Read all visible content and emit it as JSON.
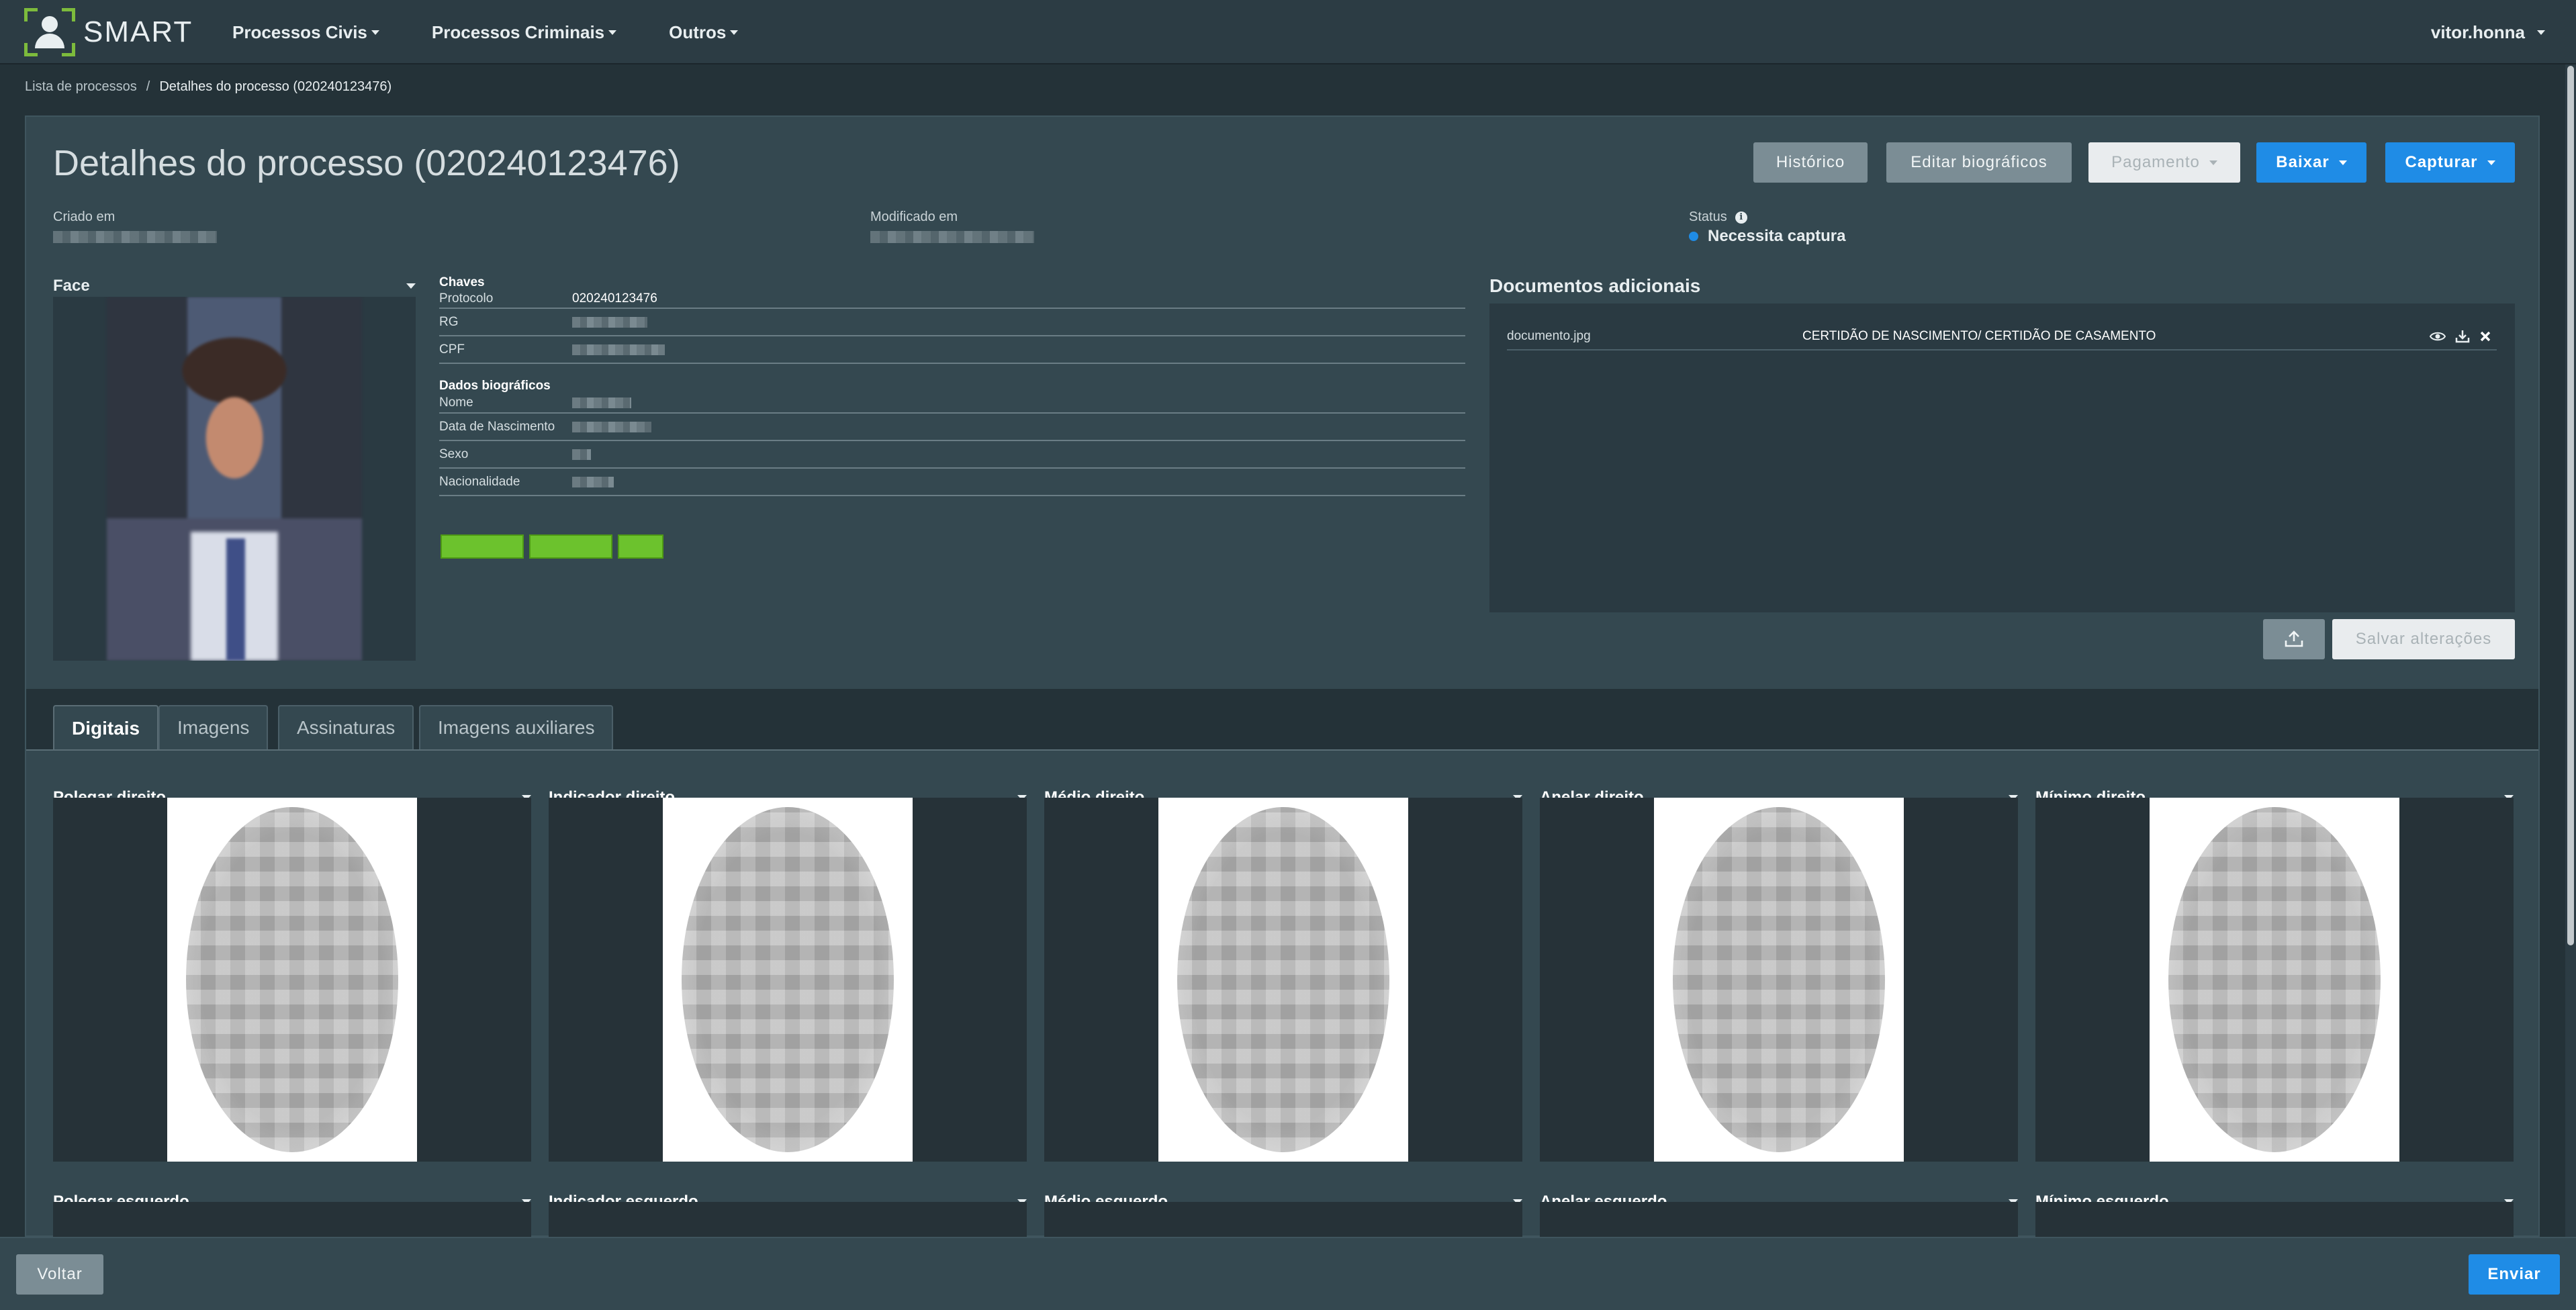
{
  "app": {
    "logo_text": "SMART"
  },
  "nav": {
    "items": [
      {
        "label": "Processos Civis"
      },
      {
        "label": "Processos Criminais"
      },
      {
        "label": "Outros"
      }
    ],
    "user": "vitor.honna"
  },
  "breadcrumb": {
    "parent": "Lista de processos",
    "separator": "/",
    "current": "Detalhes do processo (020240123476)"
  },
  "header": {
    "title": "Detalhes do processo (020240123476)",
    "buttons": {
      "historico": "Histórico",
      "editar": "Editar biográficos",
      "pagamento": "Pagamento",
      "baixar": "Baixar",
      "capturar": "Capturar"
    }
  },
  "meta": {
    "criado_label": "Criado em",
    "modificado_label": "Modificado em",
    "status_label": "Status",
    "status_value": "Necessita captura",
    "status_color": "#1f8ce6"
  },
  "face": {
    "label": "Face"
  },
  "chaves": {
    "title": "Chaves",
    "rows": [
      {
        "key": "Protocolo",
        "value": "020240123476"
      },
      {
        "key": "RG",
        "value": ""
      },
      {
        "key": "CPF",
        "value": ""
      }
    ]
  },
  "biograficos": {
    "title": "Dados biográficos",
    "rows": [
      {
        "key": "Nome"
      },
      {
        "key": "Data de Nascimento"
      },
      {
        "key": "Sexo"
      },
      {
        "key": "Nacionalidade"
      }
    ]
  },
  "documents": {
    "title": "Documentos adicionais",
    "items": [
      {
        "name": "documento.jpg",
        "type": "CERTIDÃO DE NASCIMENTO/ CERTIDÃO DE CASAMENTO"
      }
    ],
    "save_label": "Salvar alterações"
  },
  "tabs": [
    {
      "label": "Digitais",
      "active": true
    },
    {
      "label": "Imagens"
    },
    {
      "label": "Assinaturas"
    },
    {
      "label": "Imagens auxiliares"
    }
  ],
  "fingers": {
    "right": [
      "Polegar direito",
      "Indicador direito",
      "Médio direito",
      "Anelar direito",
      "Mínimo direito"
    ],
    "left": [
      "Polegar esquerdo",
      "Indicador esquerdo",
      "Médio esquerdo",
      "Anelar esquerdo",
      "Mínimo esquerdo"
    ]
  },
  "footer": {
    "voltar": "Voltar",
    "enviar": "Enviar"
  },
  "colors": {
    "accent": "#1f8ce6",
    "brand_green": "#7dbb3c",
    "chip_green": "#6cc22d"
  }
}
